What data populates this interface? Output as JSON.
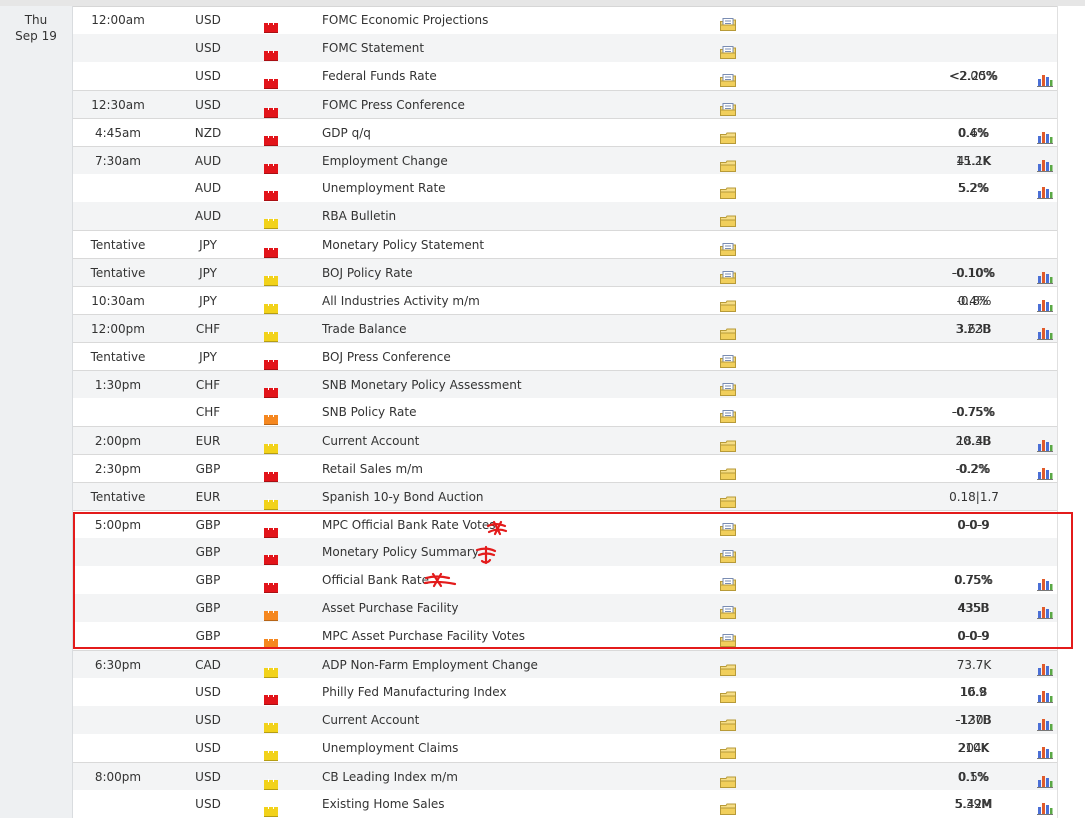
{
  "date": {
    "weekday": "Thu",
    "day": "Sep 19"
  },
  "colors": {
    "high": "#e2141a",
    "medium": "#f5871f",
    "low": "#f2d21a",
    "annotation": "#e31b1b"
  },
  "icons": {
    "impact": "impact-bars-icon",
    "detail": "folder-icon",
    "chart": "bar-chart-icon"
  },
  "rows": [
    {
      "time": "12:00am",
      "currency": "USD",
      "impact": "high",
      "event": "FOMC Economic Projections",
      "actual": "",
      "forecast": "",
      "previous": "",
      "detail_type": "report",
      "chart": false
    },
    {
      "time": "",
      "currency": "USD",
      "impact": "high",
      "event": "FOMC Statement",
      "actual": "",
      "forecast": "",
      "previous": "",
      "detail_type": "report",
      "chart": false
    },
    {
      "time": "",
      "currency": "USD",
      "impact": "high",
      "event": "Federal Funds Rate",
      "actual": "",
      "forecast": "<2.00%",
      "previous": "<2.25%",
      "detail_type": "report",
      "chart": true
    },
    {
      "time": "12:30am",
      "currency": "USD",
      "impact": "high",
      "event": "FOMC Press Conference",
      "actual": "",
      "forecast": "",
      "previous": "",
      "detail_type": "report",
      "chart": false
    },
    {
      "time": "4:45am",
      "currency": "NZD",
      "impact": "high",
      "event": "GDP q/q",
      "actual": "",
      "forecast": "0.4%",
      "previous": "0.6%",
      "detail_type": "folder",
      "chart": true
    },
    {
      "time": "7:30am",
      "currency": "AUD",
      "impact": "high",
      "event": "Employment Change",
      "actual": "",
      "forecast": "15.2K",
      "previous": "41.1K",
      "detail_type": "folder",
      "chart": true
    },
    {
      "time": "",
      "currency": "AUD",
      "impact": "high",
      "event": "Unemployment Rate",
      "actual": "",
      "forecast": "5.2%",
      "previous": "5.2%",
      "detail_type": "folder",
      "chart": true
    },
    {
      "time": "",
      "currency": "AUD",
      "impact": "low",
      "event": "RBA Bulletin",
      "actual": "",
      "forecast": "",
      "previous": "",
      "detail_type": "folder",
      "chart": false
    },
    {
      "time": "Tentative",
      "currency": "JPY",
      "impact": "high",
      "event": "Monetary Policy Statement",
      "actual": "",
      "forecast": "",
      "previous": "",
      "detail_type": "report",
      "chart": false
    },
    {
      "time": "Tentative",
      "currency": "JPY",
      "impact": "low",
      "event": "BOJ Policy Rate",
      "actual": "",
      "forecast": "-0.10%",
      "previous": "-0.10%",
      "detail_type": "report",
      "chart": true
    },
    {
      "time": "10:30am",
      "currency": "JPY",
      "impact": "low",
      "event": "All Industries Activity m/m",
      "actual": "",
      "forecast": "0.4%",
      "previous": "-0.8%",
      "detail_type": "folder",
      "chart": true
    },
    {
      "time": "12:00pm",
      "currency": "CHF",
      "impact": "low",
      "event": "Trade Balance",
      "actual": "",
      "forecast": "3.22B",
      "previous": "3.63B",
      "detail_type": "folder",
      "chart": true
    },
    {
      "time": "Tentative",
      "currency": "JPY",
      "impact": "high",
      "event": "BOJ Press Conference",
      "actual": "",
      "forecast": "",
      "previous": "",
      "detail_type": "report",
      "chart": false
    },
    {
      "time": "1:30pm",
      "currency": "CHF",
      "impact": "high",
      "event": "SNB Monetary Policy Assessment",
      "actual": "",
      "forecast": "",
      "previous": "",
      "detail_type": "report",
      "chart": false
    },
    {
      "time": "",
      "currency": "CHF",
      "impact": "medium",
      "event": "SNB Policy Rate",
      "actual": "",
      "forecast": "-0.75%",
      "previous": "-0.75%",
      "detail_type": "report",
      "chart": false
    },
    {
      "time": "2:00pm",
      "currency": "EUR",
      "impact": "low",
      "event": "Current Account",
      "actual": "",
      "forecast": "20.3B",
      "previous": "18.4B",
      "detail_type": "folder",
      "chart": true
    },
    {
      "time": "2:30pm",
      "currency": "GBP",
      "impact": "high",
      "event": "Retail Sales m/m",
      "actual": "",
      "forecast": "-0.2%",
      "previous": "0.2%",
      "detail_type": "folder",
      "chart": true
    },
    {
      "time": "Tentative",
      "currency": "EUR",
      "impact": "low",
      "event": "Spanish 10-y Bond Auction",
      "actual": "",
      "forecast": "",
      "previous": "0.18|1.7",
      "detail_type": "folder",
      "chart": false
    },
    {
      "time": "5:00pm",
      "currency": "GBP",
      "impact": "high",
      "event": "MPC Official Bank Rate Votes",
      "actual": "",
      "forecast": "0-0-9",
      "previous": "0-0-9",
      "detail_type": "report",
      "chart": false
    },
    {
      "time": "",
      "currency": "GBP",
      "impact": "high",
      "event": "Monetary Policy Summary",
      "actual": "",
      "forecast": "",
      "previous": "",
      "detail_type": "report",
      "chart": false
    },
    {
      "time": "",
      "currency": "GBP",
      "impact": "high",
      "event": "Official Bank Rate",
      "actual": "",
      "forecast": "0.75%",
      "previous": "0.75%",
      "detail_type": "report",
      "chart": true
    },
    {
      "time": "",
      "currency": "GBP",
      "impact": "medium",
      "event": "Asset Purchase Facility",
      "actual": "",
      "forecast": "435B",
      "previous": "435B",
      "detail_type": "report",
      "chart": true
    },
    {
      "time": "",
      "currency": "GBP",
      "impact": "medium",
      "event": "MPC Asset Purchase Facility Votes",
      "actual": "",
      "forecast": "0-0-9",
      "previous": "0-0-9",
      "detail_type": "report",
      "chart": false
    },
    {
      "time": "6:30pm",
      "currency": "CAD",
      "impact": "low",
      "event": "ADP Non-Farm Employment Change",
      "actual": "",
      "forecast": "",
      "previous": "73.7K",
      "detail_type": "folder",
      "chart": true
    },
    {
      "time": "",
      "currency": "USD",
      "impact": "high",
      "event": "Philly Fed Manufacturing Index",
      "actual": "",
      "forecast": "10.9",
      "previous": "16.8",
      "detail_type": "folder",
      "chart": true
    },
    {
      "time": "",
      "currency": "USD",
      "impact": "low",
      "event": "Current Account",
      "actual": "",
      "forecast": "-127B",
      "previous": "-130B",
      "detail_type": "folder",
      "chart": true
    },
    {
      "time": "",
      "currency": "USD",
      "impact": "low",
      "event": "Unemployment Claims",
      "actual": "",
      "forecast": "210K",
      "previous": "204K",
      "detail_type": "folder",
      "chart": true
    },
    {
      "time": "8:00pm",
      "currency": "USD",
      "impact": "low",
      "event": "CB Leading Index m/m",
      "actual": "",
      "forecast": "0.1%",
      "previous": "0.5%",
      "detail_type": "folder",
      "chart": true
    },
    {
      "time": "",
      "currency": "USD",
      "impact": "low",
      "event": "Existing Home Sales",
      "actual": "",
      "forecast": "5.39M",
      "previous": "5.42M",
      "detail_type": "folder",
      "chart": true
    }
  ]
}
